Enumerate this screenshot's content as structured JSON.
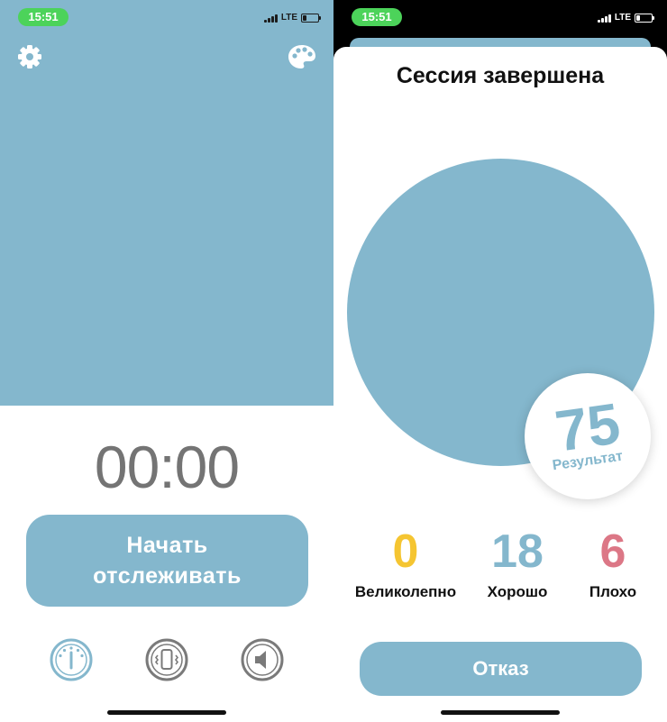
{
  "colors": {
    "accent": "#84b7cd",
    "status_time_bg": "#4cd35a",
    "great": "#f5c531",
    "good": "#84b7cd",
    "bad": "#dc7786",
    "timer_text": "#747474",
    "icon_gray": "#7a7a7a"
  },
  "left_screen": {
    "status_bar": {
      "time": "15:51",
      "network": "LTE"
    },
    "top_icons": {
      "settings_icon": "gear-icon",
      "palette_icon": "palette-icon"
    },
    "timer": "00:00",
    "start_button_label": "Начать отслеживать",
    "modes": [
      {
        "icon": "gauge-icon",
        "active": true
      },
      {
        "icon": "phone-vibrate-icon",
        "active": false
      },
      {
        "icon": "speaker-icon",
        "active": false
      }
    ]
  },
  "right_screen": {
    "status_bar": {
      "time": "15:51",
      "network": "LTE"
    },
    "title": "Сессия завершена",
    "score": {
      "value": "75",
      "label": "Результат"
    },
    "stats": [
      {
        "value": "0",
        "label": "Великолепно",
        "color": "#f5c531"
      },
      {
        "value": "18",
        "label": "Хорошо",
        "color": "#84b7cd"
      },
      {
        "value": "6",
        "label": "Плохо",
        "color": "#dc7786"
      }
    ],
    "cancel_button_label": "Отказ"
  }
}
